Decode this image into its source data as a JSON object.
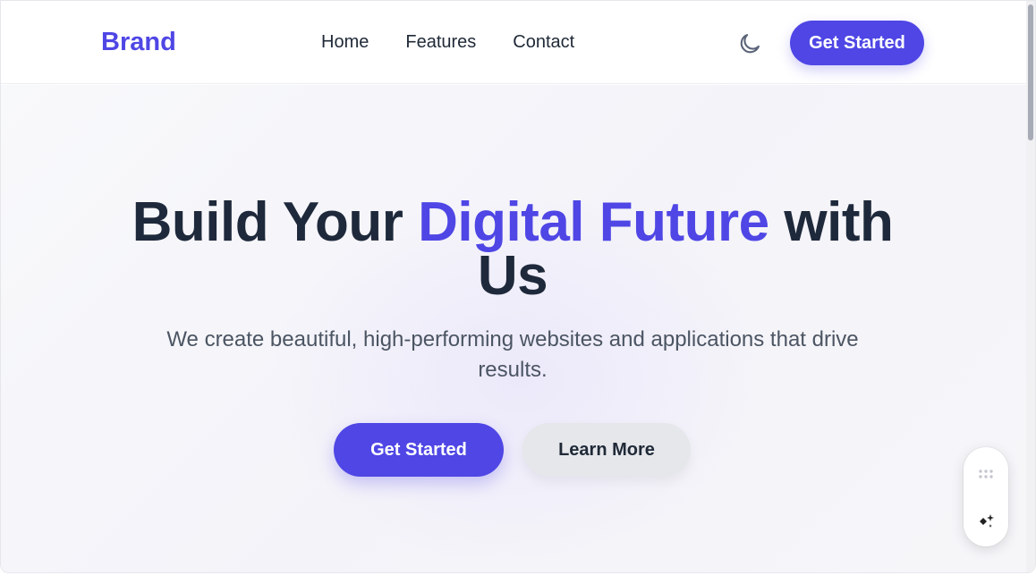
{
  "navbar": {
    "brand": "Brand",
    "links": [
      "Home",
      "Features",
      "Contact"
    ],
    "theme_icon": "moon-icon",
    "cta_label": "Get Started"
  },
  "hero": {
    "title_part1": "Build Your ",
    "title_accent": "Digital Future",
    "title_part2": " with Us",
    "subtitle": "We create beautiful, high-performing websites and applications that drive results.",
    "primary_button": "Get Started",
    "secondary_button": "Learn More"
  },
  "floating_widget": {
    "icons": [
      "drag-handle-icon",
      "sparkle-icon"
    ]
  },
  "colors": {
    "accent": "#4f46e5",
    "heading": "#1e293b",
    "body_text": "#4b5563",
    "secondary_button_bg": "#e5e7eb"
  }
}
